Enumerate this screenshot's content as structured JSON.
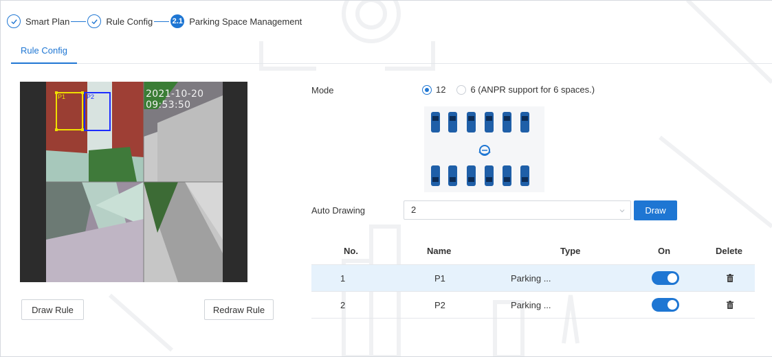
{
  "steps": [
    {
      "label": "Smart Plan",
      "state": "done"
    },
    {
      "label": "Rule Config",
      "state": "done"
    },
    {
      "label": "Parking Space Management",
      "state": "active",
      "number": "2.1"
    }
  ],
  "tabs": [
    {
      "label": "Rule Config",
      "active": true
    }
  ],
  "video": {
    "timestamp": "2021-10-20 09:53:50",
    "zones": [
      {
        "label": "P1",
        "color": "#f0e000"
      },
      {
        "label": "P2",
        "color": "#1c2cff"
      }
    ]
  },
  "buttons": {
    "draw_rule": "Draw Rule",
    "redraw_rule": "Redraw Rule",
    "draw": "Draw"
  },
  "mode": {
    "label": "Mode",
    "options": [
      {
        "label": "12",
        "selected": true
      },
      {
        "label": "6 (ANPR support for 6 spaces.)",
        "selected": false
      }
    ]
  },
  "auto_drawing": {
    "label": "Auto Drawing",
    "value": "2"
  },
  "table": {
    "headers": {
      "no": "No.",
      "name": "Name",
      "type": "Type",
      "on": "On",
      "delete": "Delete"
    },
    "rows": [
      {
        "no": "1",
        "name": "P1",
        "type": "Parking ...",
        "on": true,
        "selected": true
      },
      {
        "no": "2",
        "name": "P2",
        "type": "Parking ...",
        "on": true,
        "selected": false
      }
    ]
  },
  "colors": {
    "accent": "#1e76d3",
    "row_selected": "#e6f2fc",
    "zone_p1": "#f0e000",
    "zone_p2": "#1c2cff"
  }
}
